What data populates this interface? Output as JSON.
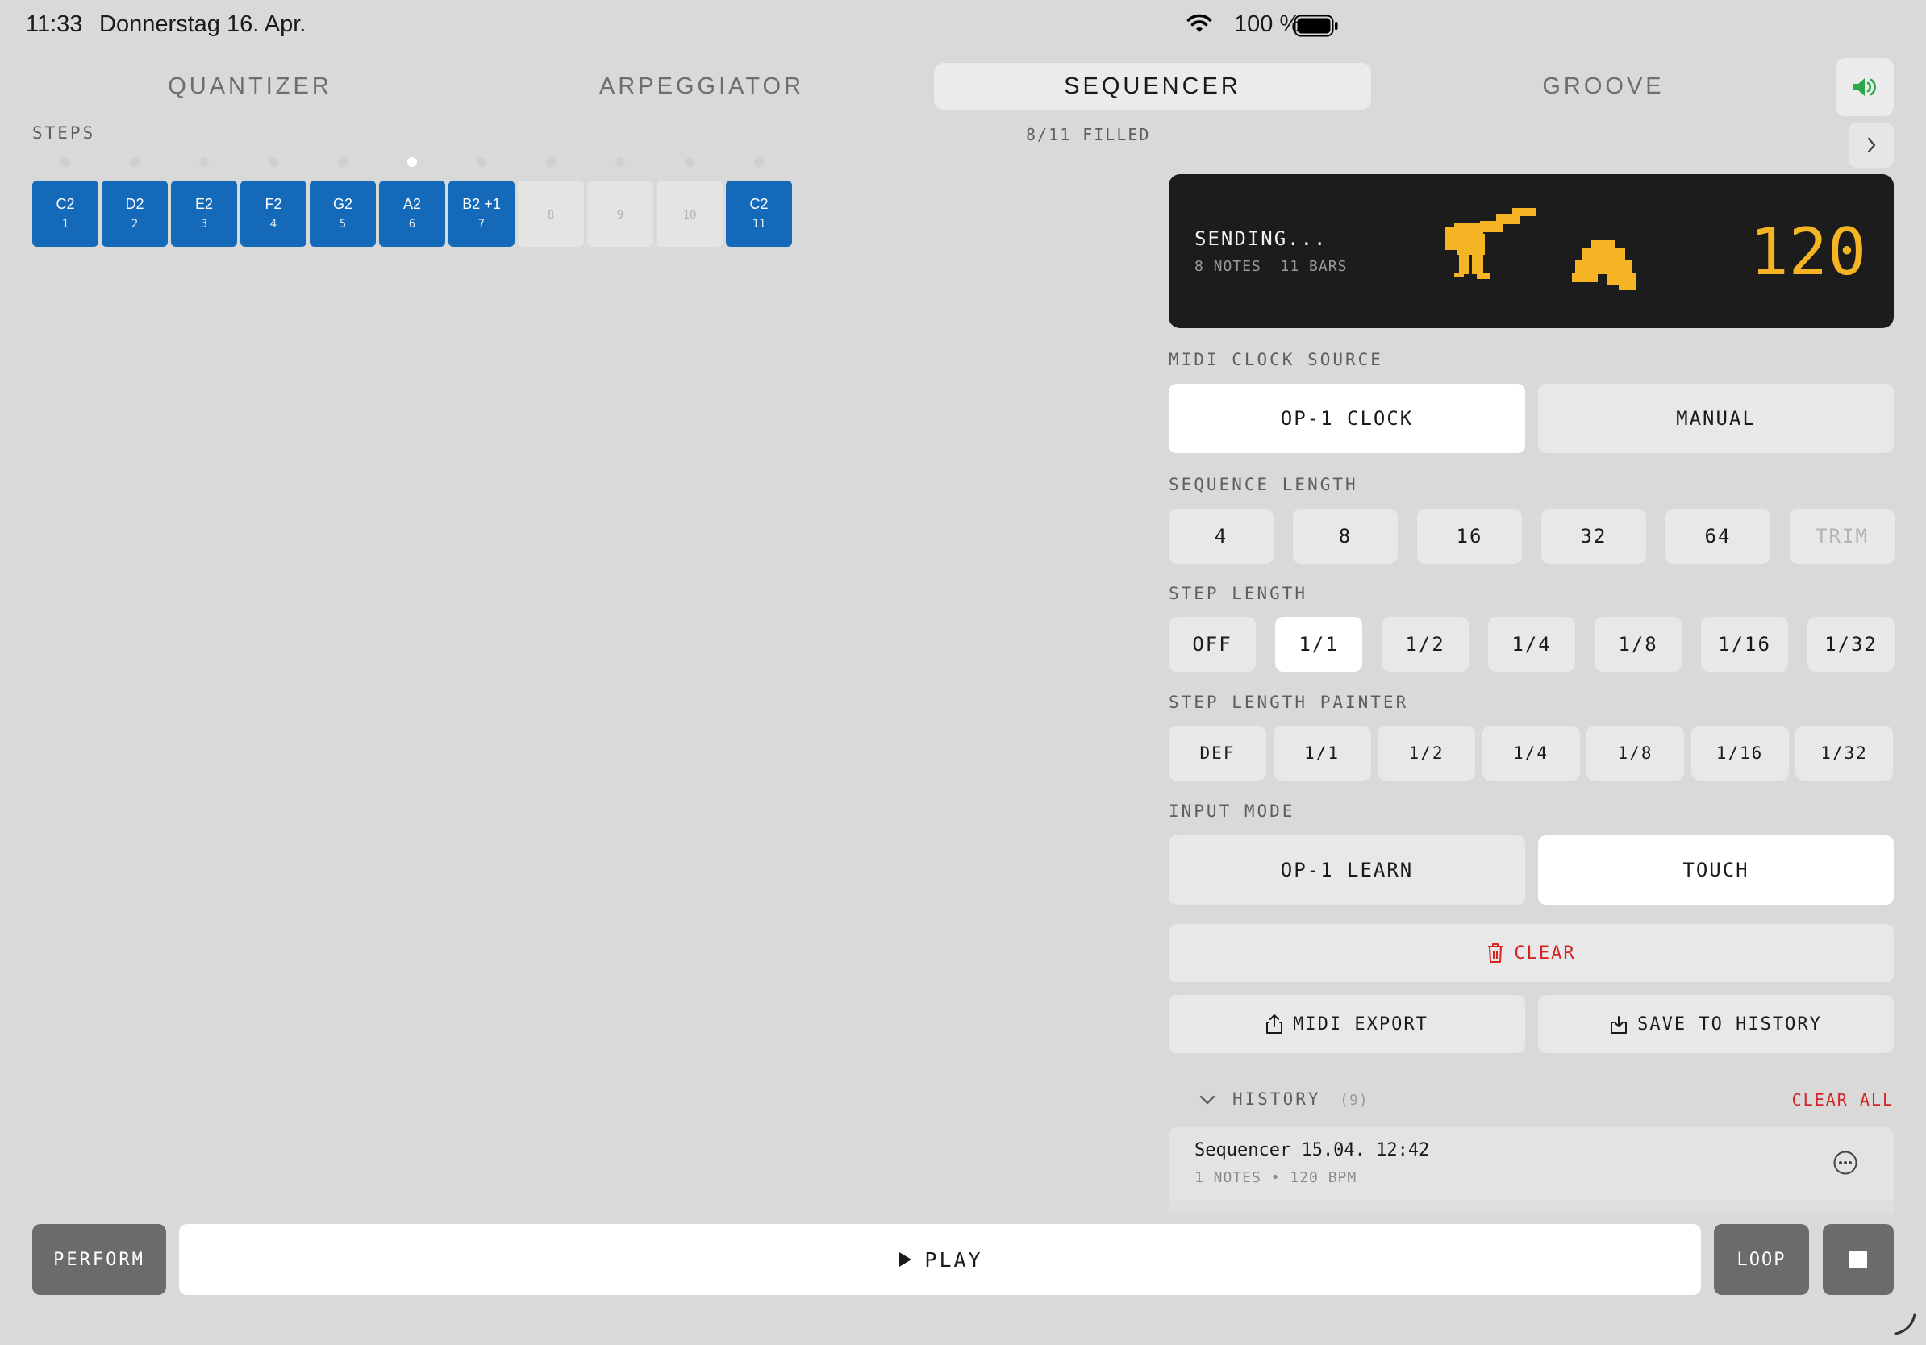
{
  "status_bar": {
    "time": "11:33",
    "date": "Donnerstag 16. Apr.",
    "battery": "100 %"
  },
  "tabs": [
    {
      "label": "QUANTIZER",
      "active": false
    },
    {
      "label": "ARPEGGIATOR",
      "active": false
    },
    {
      "label": "SEQUENCER",
      "active": true
    },
    {
      "label": "GROOVE",
      "active": false
    }
  ],
  "steps": {
    "label": "STEPS",
    "filled": "8/11 FILLED",
    "active_step": 6,
    "items": [
      {
        "note": "C2",
        "num": "1",
        "filled": true
      },
      {
        "note": "D2",
        "num": "2",
        "filled": true
      },
      {
        "note": "E2",
        "num": "3",
        "filled": true
      },
      {
        "note": "F2",
        "num": "4",
        "filled": true
      },
      {
        "note": "G2",
        "num": "5",
        "filled": true
      },
      {
        "note": "A2",
        "num": "6",
        "filled": true
      },
      {
        "note": "B2 +1",
        "num": "7",
        "filled": true
      },
      {
        "note": "",
        "num": "8",
        "filled": false
      },
      {
        "note": "",
        "num": "9",
        "filled": false
      },
      {
        "note": "",
        "num": "10",
        "filled": false
      },
      {
        "note": "C2",
        "num": "11",
        "filled": true
      }
    ]
  },
  "display": {
    "status": "SENDING...",
    "notes": "8 NOTES",
    "bars": "11 BARS",
    "bpm": "120",
    "accent": "#f5b423"
  },
  "midi_clock": {
    "label": "MIDI CLOCK SOURCE",
    "options": [
      "OP-1 CLOCK",
      "MANUAL"
    ],
    "selected": "OP-1 CLOCK"
  },
  "sequence_length": {
    "label": "SEQUENCE LENGTH",
    "options": [
      "4",
      "8",
      "16",
      "32",
      "64",
      "TRIM"
    ],
    "disabled": "TRIM"
  },
  "step_length": {
    "label": "STEP LENGTH",
    "options": [
      "OFF",
      "1/1",
      "1/2",
      "1/4",
      "1/8",
      "1/16",
      "1/32"
    ],
    "selected": "1/1"
  },
  "step_length_painter": {
    "label": "STEP LENGTH PAINTER",
    "options": [
      "DEF",
      "1/1",
      "1/2",
      "1/4",
      "1/8",
      "1/16",
      "1/32"
    ]
  },
  "input_mode": {
    "label": "INPUT MODE",
    "options": [
      "OP-1 LEARN",
      "TOUCH"
    ],
    "selected": "TOUCH"
  },
  "actions": {
    "clear": "CLEAR",
    "midi_export": "MIDI EXPORT",
    "save_history": "SAVE TO HISTORY"
  },
  "history": {
    "label": "HISTORY",
    "count": "(9)",
    "clear_all": "CLEAR ALL",
    "items": [
      {
        "title": "Sequencer 15.04. 12:42",
        "notes": "1 NOTES",
        "bpm": "120 BPM"
      }
    ]
  },
  "transport": {
    "perform": "PERFORM",
    "play": "PLAY",
    "loop": "LOOP"
  },
  "colors": {
    "step_filled": "#1469b8",
    "danger": "#d42424",
    "speaker": "#2aa84a",
    "background": "#d9d9d9"
  }
}
